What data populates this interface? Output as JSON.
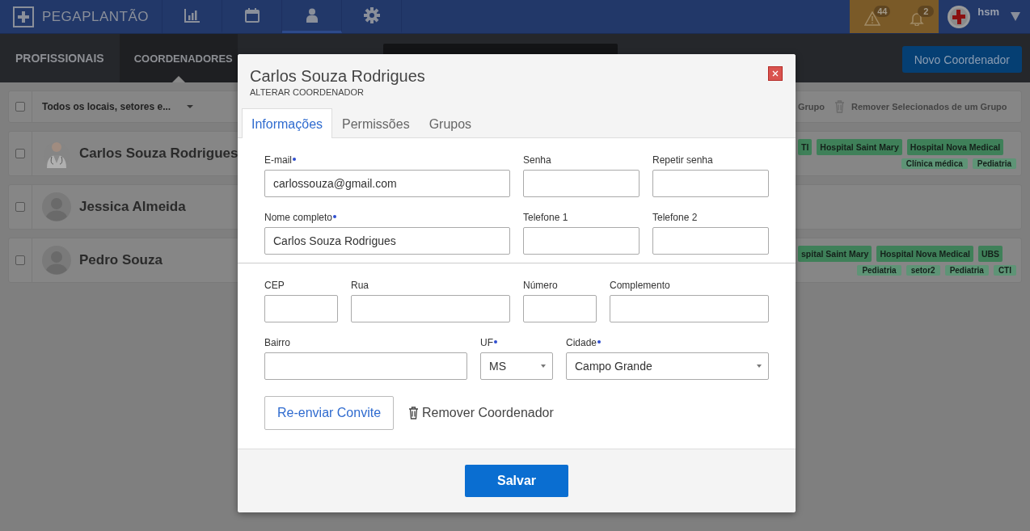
{
  "topbar": {
    "logo": "PEGAPLANTÃO",
    "nav": [
      {
        "kind": "chart",
        "selected": false
      },
      {
        "kind": "calendar",
        "selected": false
      },
      {
        "kind": "person",
        "selected": true
      },
      {
        "kind": "gear",
        "selected": false
      }
    ],
    "alerts": [
      {
        "kind": "warning",
        "count": "44"
      },
      {
        "kind": "bell",
        "count": "2"
      }
    ],
    "user": "hsm"
  },
  "subnav": {
    "tabs": [
      {
        "label": "PROFISSIONAIS",
        "selected": false
      },
      {
        "label": "COORDENADORES",
        "selected": true
      }
    ],
    "new_button": "Novo Coordenador"
  },
  "toolbar": {
    "checked": false,
    "filter": "Todos os locais, setores e...",
    "actions": [
      {
        "label": "Grupo",
        "kind": "text"
      },
      {
        "label": "Remover Selecionados de um Grupo",
        "kind": "trash"
      }
    ]
  },
  "list": [
    {
      "name": "Carlos Souza Rodrigues",
      "checked": false,
      "tags": [
        {
          "label": "TI",
          "color": "#3f8059"
        },
        {
          "label": "Hospital Saint Mary",
          "color": "#3f8059"
        },
        {
          "label": "Hospital Nova Medical",
          "color": "#3f8059"
        }
      ],
      "sub_tags": [
        {
          "label": "Clínica médica",
          "color": "#5e9476"
        },
        {
          "label": "Pediatria",
          "color": "#5e9476"
        }
      ]
    },
    {
      "name": "Jessica Almeida",
      "kind": "silhouette",
      "checked": false
    },
    {
      "name": "Pedro Souza",
      "kind": "silhouette",
      "checked": false,
      "tags": [
        {
          "label": "spital Saint Mary",
          "color": "#3f8059"
        },
        {
          "label": "Hospital Nova Medical",
          "color": "#3f8059"
        },
        {
          "label": "UBS",
          "color": "#3f8059"
        }
      ],
      "sub_tags": [
        {
          "label": "Pediatria",
          "color": "#5e9476"
        },
        {
          "label": "setor2",
          "color": "#5e9476"
        },
        {
          "label": "Pediatria",
          "color": "#5e9476"
        },
        {
          "label": "CTI",
          "color": "#5e9476"
        }
      ]
    }
  ],
  "modal": {
    "title": "Carlos Souza Rodrigues",
    "subtitle": "ALTERAR COORDENADOR",
    "tabs": [
      {
        "label": "Informações",
        "selected": true
      },
      {
        "label": "Permissões",
        "selected": false
      },
      {
        "label": "Grupos",
        "selected": false
      }
    ],
    "sections": [
      [
        [
          {
            "label": "E-mail",
            "required": true,
            "kind": "text",
            "value": "carlossouza@gmail.com"
          },
          {
            "label": "Senha",
            "required": false,
            "kind": "password"
          },
          {
            "label": "Repetir senha",
            "required": false,
            "kind": "password"
          }
        ],
        [
          {
            "label": "Nome completo",
            "required": true,
            "kind": "text",
            "value": "Carlos Souza Rodrigues"
          },
          {
            "label": "Telefone 1",
            "required": false,
            "kind": "text"
          },
          {
            "label": "Telefone 2",
            "required": false,
            "kind": "text"
          }
        ]
      ],
      [
        [
          {
            "label": "CEP",
            "required": false,
            "kind": "text"
          },
          {
            "label": "Rua",
            "required": false,
            "kind": "text"
          },
          {
            "label": "Número",
            "required": false,
            "kind": "text"
          },
          {
            "label": "Complemento",
            "required": false,
            "kind": "text"
          }
        ],
        [
          {
            "label": "Bairro",
            "required": false,
            "kind": "text"
          },
          {
            "label": "UF",
            "required": true,
            "kind": "select",
            "value": "MS"
          },
          {
            "label": "Cidade",
            "required": true,
            "kind": "select",
            "value": "Campo Grande"
          }
        ]
      ]
    ],
    "resend_button": "Re-enviar Convite",
    "remove_button": "Remover Coordenador",
    "save_button": "Salvar"
  }
}
